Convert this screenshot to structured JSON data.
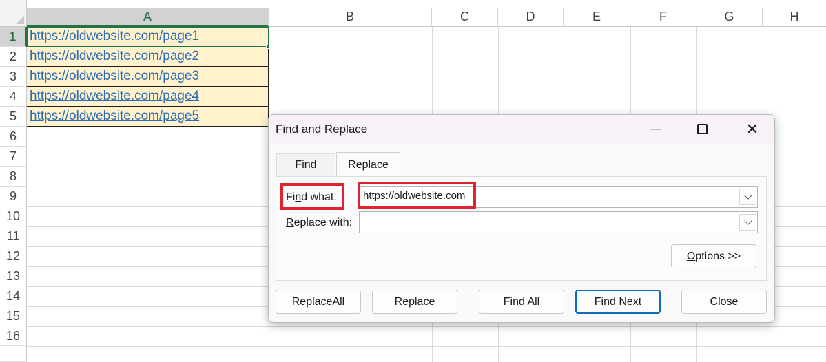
{
  "sheet": {
    "columns": [
      "A",
      "B",
      "C",
      "D",
      "E",
      "F",
      "G",
      "H"
    ],
    "rows": [
      "1",
      "2",
      "3",
      "4",
      "5",
      "6",
      "7",
      "8",
      "9",
      "10",
      "11",
      "12",
      "13",
      "14",
      "15",
      "16"
    ],
    "cells": [
      "https://oldwebsite.com/page1",
      "https://oldwebsite.com/page2",
      "https://oldwebsite.com/page3",
      "https://oldwebsite.com/page4",
      "https://oldwebsite.com/page5"
    ]
  },
  "dialog": {
    "title": "Find and Replace",
    "tabs": {
      "find": [
        "Fi",
        "n",
        "d"
      ],
      "replace": "Replace"
    },
    "find_what": {
      "label": [
        "Fi",
        "n",
        "d what:"
      ],
      "value": "https://oldwebsite.com"
    },
    "replace_with": {
      "label": [
        "",
        "R",
        "eplace with:"
      ],
      "value": ""
    },
    "buttons": {
      "options": [
        "",
        "O",
        "ptions >>"
      ],
      "replace_all": [
        "Replace ",
        "A",
        "ll"
      ],
      "replace": [
        "",
        "R",
        "eplace"
      ],
      "find_all": [
        "F",
        "i",
        "nd All"
      ],
      "find_next": [
        "",
        "F",
        "ind Next"
      ],
      "close": "Close"
    }
  },
  "colors": {
    "accent": "#217346",
    "highlight": "#e1232d",
    "link": "#2f6db3",
    "cell_fill": "#fff2cc",
    "dialog_focus": "#0f6cbd"
  }
}
